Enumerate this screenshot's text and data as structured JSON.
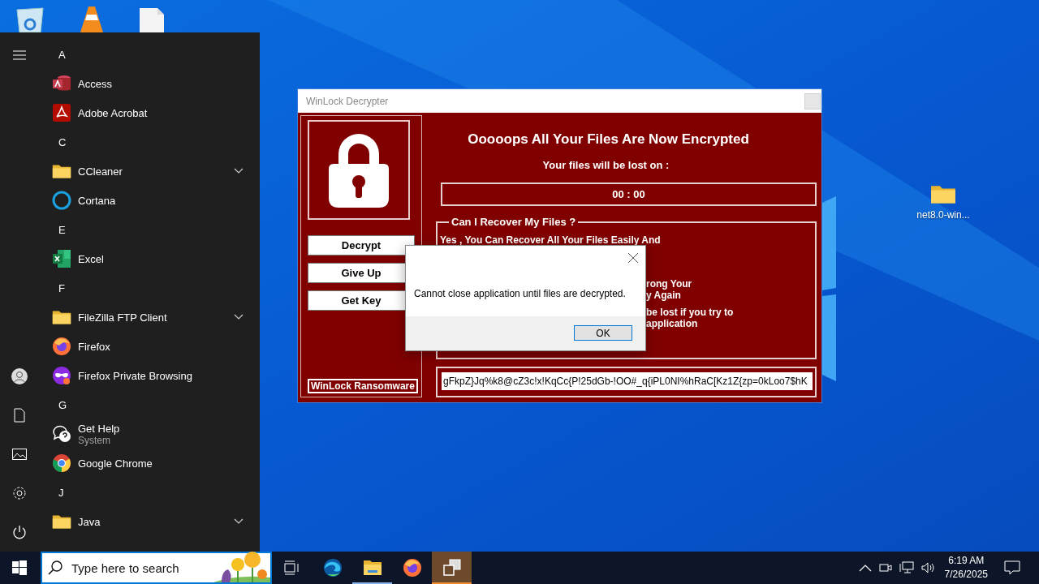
{
  "desktop": {
    "icons": [
      {
        "label": "net8.0-win...",
        "kind": "folder"
      }
    ]
  },
  "start_menu": {
    "groups": [
      {
        "letter": "A",
        "apps": [
          {
            "name": "Access",
            "kind": "access",
            "expandable": false
          },
          {
            "name": "Adobe Acrobat",
            "kind": "acrobat",
            "expandable": false
          }
        ]
      },
      {
        "letter": "C",
        "apps": [
          {
            "name": "CCleaner",
            "kind": "folder",
            "expandable": true
          },
          {
            "name": "Cortana",
            "kind": "cortana",
            "expandable": false
          }
        ]
      },
      {
        "letter": "E",
        "apps": [
          {
            "name": "Excel",
            "kind": "excel",
            "expandable": false
          }
        ]
      },
      {
        "letter": "F",
        "apps": [
          {
            "name": "FileZilla FTP Client",
            "kind": "folder",
            "expandable": true
          },
          {
            "name": "Firefox",
            "kind": "firefox",
            "expandable": false
          },
          {
            "name": "Firefox Private Browsing",
            "kind": "private",
            "expandable": false
          }
        ]
      },
      {
        "letter": "G",
        "apps": [
          {
            "name": "Get Help",
            "subtitle": "System",
            "kind": "help",
            "expandable": false
          },
          {
            "name": "Google Chrome",
            "kind": "chrome",
            "expandable": false
          }
        ]
      },
      {
        "letter": "J",
        "apps": [
          {
            "name": "Java",
            "kind": "folder",
            "expandable": true
          }
        ]
      }
    ]
  },
  "ransom_window": {
    "title": "WinLock Decrypter",
    "buttons": [
      "Decrypt",
      "Give Up",
      "Get Key"
    ],
    "brand": "WinLock Ransomware",
    "heading": "Ooooops All Your Files Are Now Encrypted",
    "deadline_label": "Your files will be lost on :",
    "timer": "00 : 00",
    "recover_box": {
      "title": "Can I Recover My Files ?",
      "lines": [
        "Yes , You Can Recover All Your Files Easily And"
      ],
      "partly_hidden_lines": [
        [
          "rong Your",
          "y Again"
        ],
        [
          "be lost if you try to",
          "application"
        ]
      ]
    },
    "key": "gFkpZ}Jq%k8@cZ3c!x!KqCc{P!25dGb-!OO#_q{iPL0NI%hRaC[Kz1Z{zp=0kLoo7$hK"
  },
  "message_box": {
    "message": "Cannot close application until files are decrypted.",
    "button": "OK"
  },
  "taskbar": {
    "search_placeholder": "Type here to search",
    "apps": [
      {
        "kind": "edge",
        "open": false,
        "selected": false
      },
      {
        "kind": "explorer",
        "open": true,
        "selected": false
      },
      {
        "kind": "firefox",
        "open": false,
        "selected": false
      },
      {
        "kind": "window",
        "open": true,
        "selected": true
      }
    ],
    "time": "6:19 AM",
    "date": "7/26/2025"
  }
}
